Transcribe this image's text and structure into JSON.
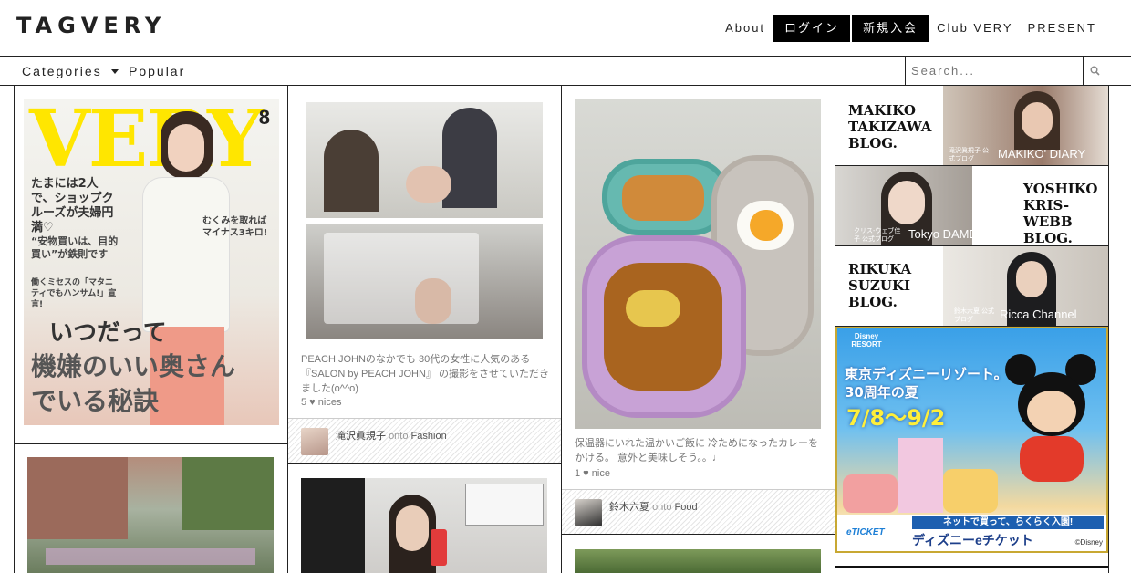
{
  "header": {
    "logo": "TAGVERY",
    "nav": {
      "about": "About",
      "login": "ログイン",
      "register": "新規入会",
      "club": "Club VERY",
      "present": "PRESENT"
    }
  },
  "subnav": {
    "categories": "Categories",
    "popular": "Popular",
    "search_placeholder": "Search..."
  },
  "magazine": {
    "title": "VERY",
    "issue": "8",
    "headline_1": "たまには2人で、ショップクルーズが夫婦円満♡",
    "headline_2": "“安物買いは、目的買い”が鉄則です",
    "headline_3": "働くミセスの「マタニティでもハンサム!」宣言!",
    "headline_4": "むくみを取ればマイナス3キロ!",
    "big_1": "いつだって",
    "big_2": "機嫌のいい奥さん",
    "big_3": "でいる秘訣"
  },
  "pins": [
    {
      "desc": "PEACH JOHNのなかでも 30代の女性に人気のある『SALON by PEACH JOHN』 の撮影をさせていただきました(o^^o)",
      "nices": "5 ♥ nices",
      "user": "滝沢眞規子",
      "onto": "onto",
      "board": "Fashion"
    },
    {
      "desc": "保温器にいれた温かいご飯に 冷ためになったカレーをかける。 意外と美味しそう。。♩",
      "nices": "1 ♥ nice",
      "user": "鈴木六夏",
      "onto": "onto",
      "board": "Food"
    }
  ],
  "blogs": [
    {
      "name": "MAKIKO TAKIZAWA BLOG.",
      "tag": "MAKIKO' DIARY",
      "sub": "滝沢眞規子 公式ブログ"
    },
    {
      "name": "YOSHIKO KRIS-WEBB BLOG.",
      "tag": "Tokyo DAME",
      "sub": "クリス-ウェブ佳子 公式ブログ"
    },
    {
      "name": "RIKUKA SUZUKI BLOG.",
      "tag": "Ricca Channel",
      "sub": "鈴木六夏 公式ブログ"
    }
  ],
  "ad": {
    "brand": "Disney RESORT",
    "headline": "東京ディズニーリゾート。30周年の夏",
    "dates": "7/8〜9/2",
    "cta": "ネットで買って、らくらく入園!",
    "ticket": "ディズニーeチケット",
    "eticket": "eTICKET",
    "copyright": "©Disney"
  },
  "colors": {
    "yellow": "#ffe600",
    "ad_blue": "#1d7fd6",
    "ad_border": "#c8a832"
  }
}
